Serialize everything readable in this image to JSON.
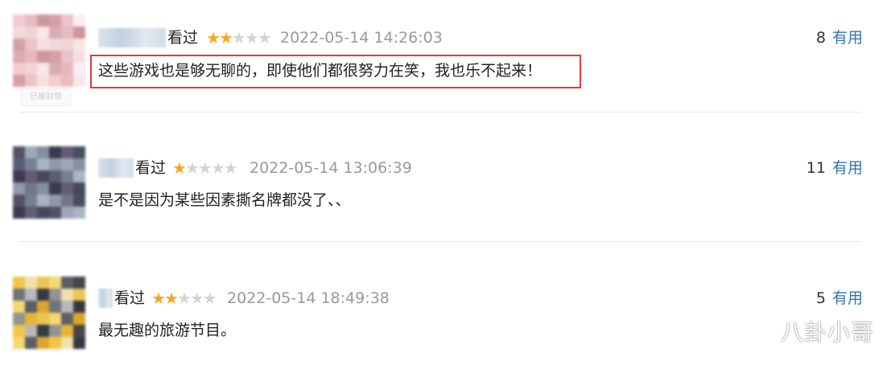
{
  "comments": [
    {
      "watched_label": "看过",
      "rating_stars": 2,
      "rating_max": 5,
      "timestamp": "2022-05-14 14:26:03",
      "useful_count": "8",
      "useful_label": "有用",
      "text": "这些游戏也是够无聊的，即使他们都很努力在笑，我也乐不起来！",
      "highlighted": true,
      "avatar_tag": "已被封禁"
    },
    {
      "watched_label": "看过",
      "rating_stars": 1,
      "rating_max": 5,
      "timestamp": "2022-05-14 13:06:39",
      "useful_count": "11",
      "useful_label": "有用",
      "text": "是不是因为某些因素撕名牌都没了、、",
      "highlighted": false
    },
    {
      "watched_label": "看过",
      "rating_stars": 2,
      "rating_max": 5,
      "timestamp": "2022-05-14 18:49:38",
      "useful_count": "5",
      "useful_label": "有用",
      "text": "最无趣的旅游节目。",
      "highlighted": false
    }
  ],
  "colors": {
    "link": "#3377aa",
    "star_on": "#f5a623",
    "star_off": "#d4d4d4",
    "highlight_border": "#e03a3a"
  },
  "watermark": "八卦小哥"
}
